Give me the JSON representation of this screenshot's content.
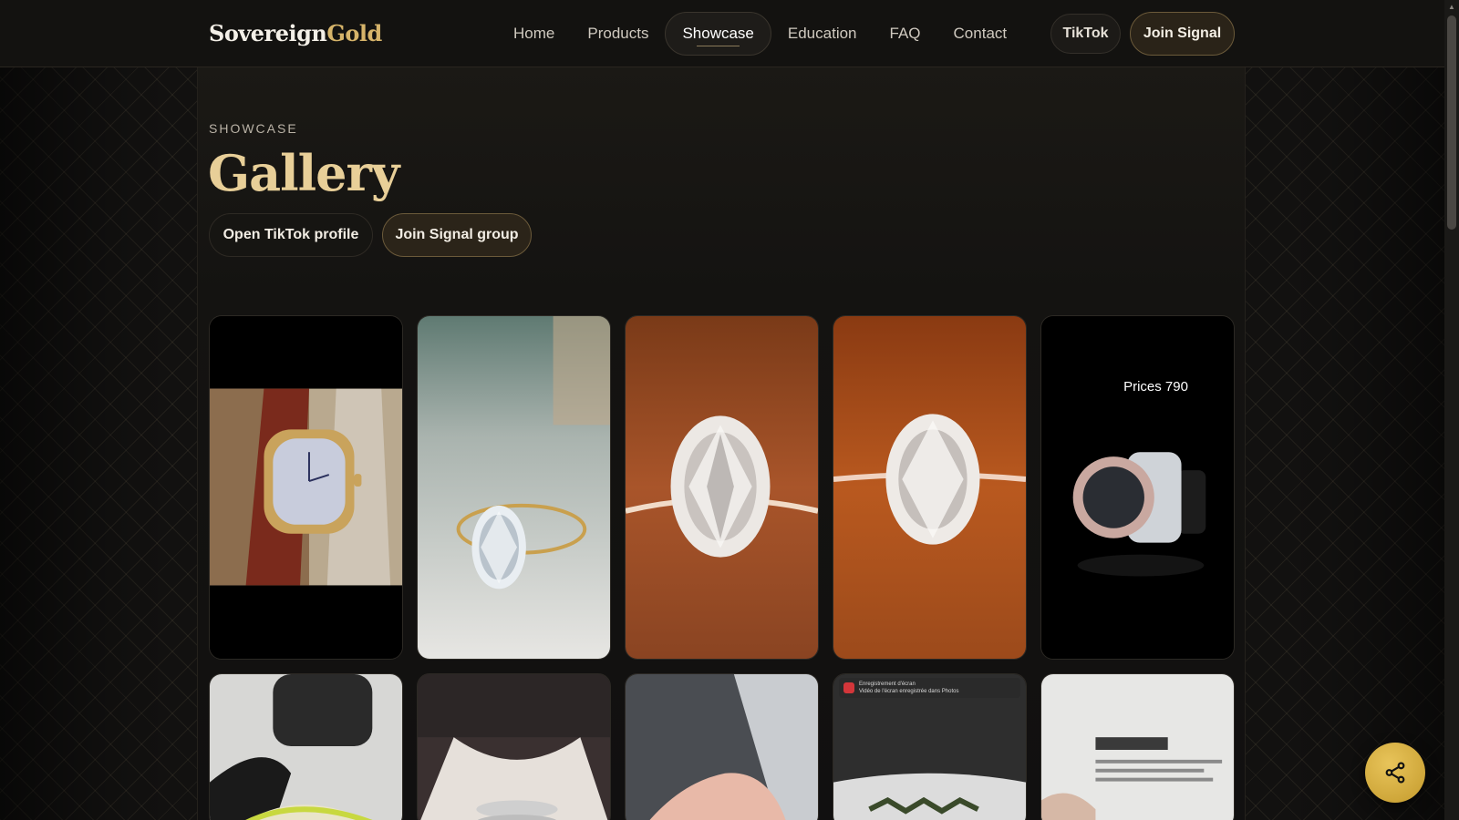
{
  "brand": {
    "part1": "Sovereign",
    "part2": "Gold"
  },
  "nav": {
    "items": [
      {
        "label": "Home"
      },
      {
        "label": "Products"
      },
      {
        "label": "Showcase",
        "active": true
      },
      {
        "label": "Education"
      },
      {
        "label": "FAQ"
      },
      {
        "label": "Contact"
      }
    ],
    "tiktok_label": "TikTok",
    "signal_label": "Join Signal"
  },
  "hero": {
    "eyebrow": "SHOWCASE",
    "title": "Gallery",
    "open_tiktok_label": "Open TikTok profile",
    "join_signal_label": "Join Signal group"
  },
  "gallery": {
    "price_overlay": "Prices 790",
    "recording_title": "Enregistrement d'écran",
    "recording_sub": "Vidéo de l'écran enregistrée dans Photos"
  },
  "colors": {
    "accent_gold": "#d6b46a",
    "title_gold": "#e8cf98",
    "background": "#0c0b09"
  },
  "icons": {
    "share": "share-icon"
  }
}
